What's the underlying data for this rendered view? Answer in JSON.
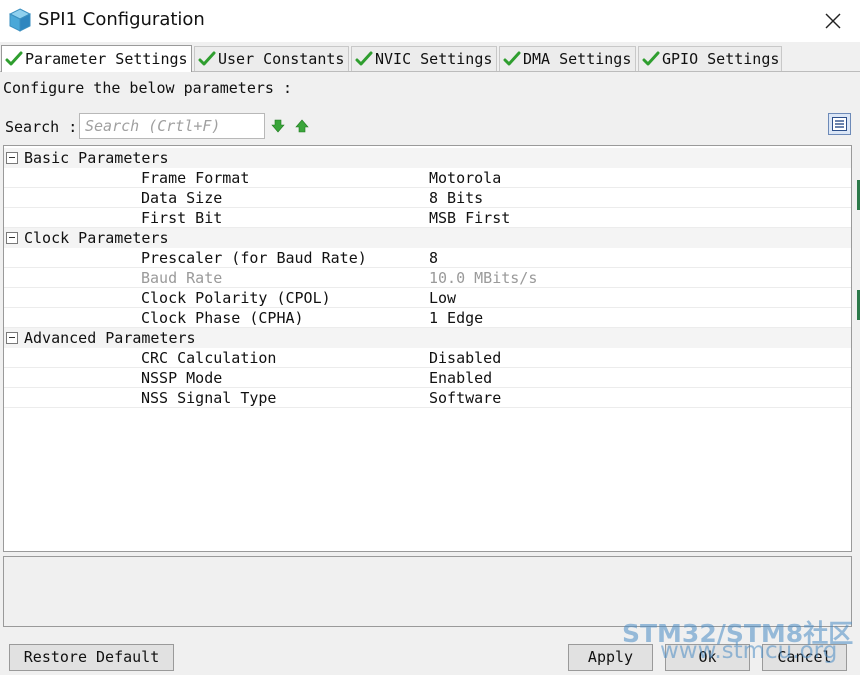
{
  "window": {
    "title": "SPI1 Configuration",
    "icon": "cube-icon",
    "close_icon": "close-icon"
  },
  "tabs": [
    {
      "label": "Parameter Settings",
      "active": true,
      "icon": "green-check-icon"
    },
    {
      "label": "User Constants",
      "active": false,
      "icon": "green-check-icon"
    },
    {
      "label": "NVIC Settings",
      "active": false,
      "icon": "green-check-icon"
    },
    {
      "label": "DMA Settings",
      "active": false,
      "icon": "green-check-icon"
    },
    {
      "label": "GPIO Settings",
      "active": false,
      "icon": "green-check-icon"
    }
  ],
  "main": {
    "configure_text": "Configure the below parameters :",
    "search_label": "Search :",
    "search_placeholder": "Search (Crtl+F)",
    "search_value": ""
  },
  "groups": [
    {
      "label": "Basic Parameters",
      "params": [
        {
          "name": "Frame Format",
          "value": "Motorola",
          "enabled": true
        },
        {
          "name": "Data Size",
          "value": "8 Bits",
          "enabled": true
        },
        {
          "name": "First Bit",
          "value": "MSB First",
          "enabled": true
        }
      ]
    },
    {
      "label": "Clock Parameters",
      "params": [
        {
          "name": "Prescaler (for Baud Rate)",
          "value": "8",
          "enabled": true
        },
        {
          "name": "Baud Rate",
          "value": "10.0 MBits/s",
          "enabled": false
        },
        {
          "name": "Clock Polarity (CPOL)",
          "value": "Low",
          "enabled": true
        },
        {
          "name": "Clock Phase (CPHA)",
          "value": "1 Edge",
          "enabled": true
        }
      ]
    },
    {
      "label": "Advanced Parameters",
      "params": [
        {
          "name": "CRC Calculation",
          "value": "Disabled",
          "enabled": true
        },
        {
          "name": "NSSP Mode",
          "value": "Enabled",
          "enabled": true
        },
        {
          "name": "NSS Signal Type",
          "value": "Software",
          "enabled": true
        }
      ]
    }
  ],
  "buttons": {
    "restore_default": "Restore Default",
    "apply": "Apply",
    "ok": "Ok",
    "cancel": "Cancel"
  },
  "watermark": {
    "line1": "STM32/STM8社区",
    "line2": "www.stmcu.org"
  },
  "colors": {
    "check_green": "#2f9e2f",
    "arrow_green": "#3aa53a",
    "watermark_blue": "#4a8cc4"
  }
}
